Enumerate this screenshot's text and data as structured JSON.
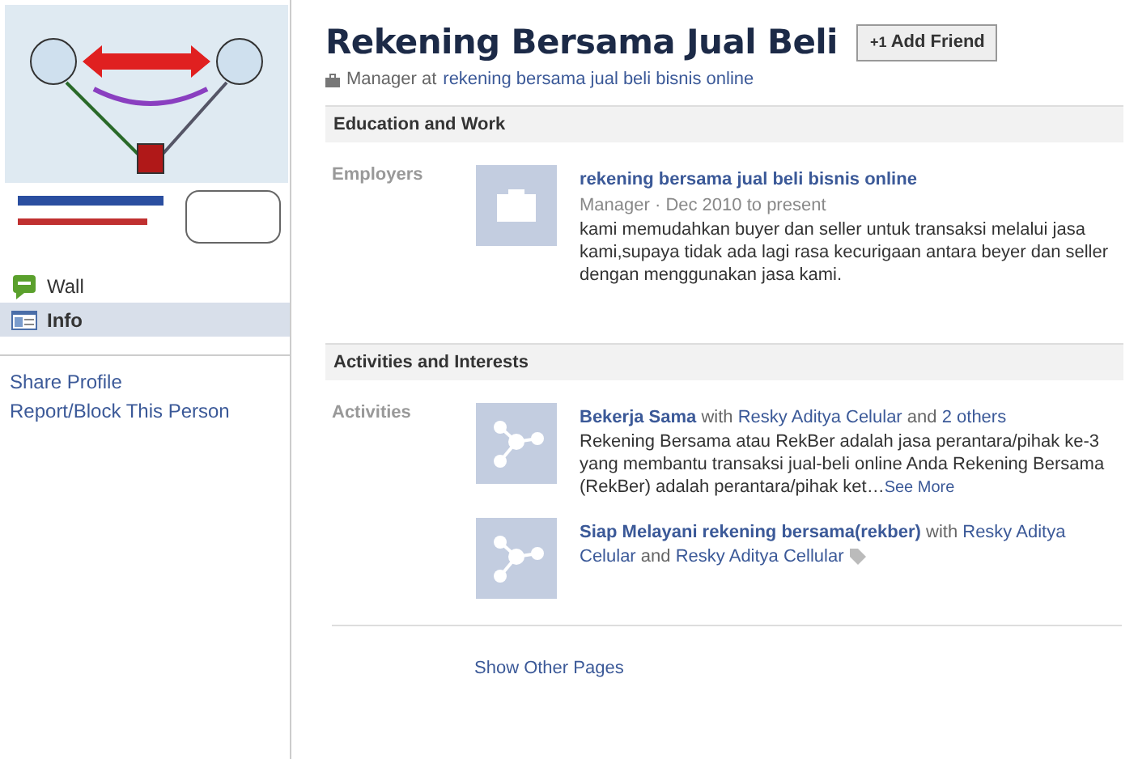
{
  "sidebar": {
    "items": [
      {
        "label": "Wall",
        "selected": false
      },
      {
        "label": "Info",
        "selected": true
      }
    ],
    "links": [
      "Share Profile",
      "Report/Block This Person"
    ]
  },
  "profile": {
    "name": "Rekening Bersama Jual Beli",
    "add_friend": "Add Friend",
    "add_icon": "+1",
    "job_prefix": "Manager at",
    "job_link": "rekening bersama jual beli bisnis online"
  },
  "sections": [
    {
      "title": "Education and Work",
      "label": "Employers",
      "entries": [
        {
          "kind": "work",
          "title": "rekening bersama jual beli bisnis online",
          "meta": "Manager · Dec 2010 to present",
          "description": "kami memudahkan buyer dan seller untuk transaksi melalui jasa kami,supaya tidak ada lagi rasa kecurigaan antara beyer dan seller dengan menggunakan jasa kami."
        }
      ]
    },
    {
      "title": "Activities and Interests",
      "label": "Activities",
      "entries": [
        {
          "kind": "activity",
          "title": "Bekerja Sama",
          "with": [
            {
              "text": "with",
              "link": false
            },
            {
              "text": "Resky Aditya Celular",
              "link": true
            },
            {
              "text": "and",
              "link": false
            },
            {
              "text": "2 others",
              "link": true
            }
          ],
          "description": "Rekening Bersama atau RekBer adalah jasa perantara/pihak ke-3 yang membantu transaksi jual-beli online Anda Rekening Bersama (RekBer) adalah perantara/pihak ket…",
          "more": "See More"
        },
        {
          "kind": "activity",
          "title": "Siap Melayani rekening bersama(rekber)",
          "with": [
            {
              "text": "with",
              "link": false
            },
            {
              "text": "Resky Aditya",
              "link": true
            },
            {
              "text": "Celular",
              "link": true
            },
            {
              "text": "and",
              "link": false
            },
            {
              "text": "Resky Aditya Cellular",
              "link": true
            }
          ],
          "tagged": true
        }
      ]
    }
  ],
  "footer_link": "Show Other Pages"
}
